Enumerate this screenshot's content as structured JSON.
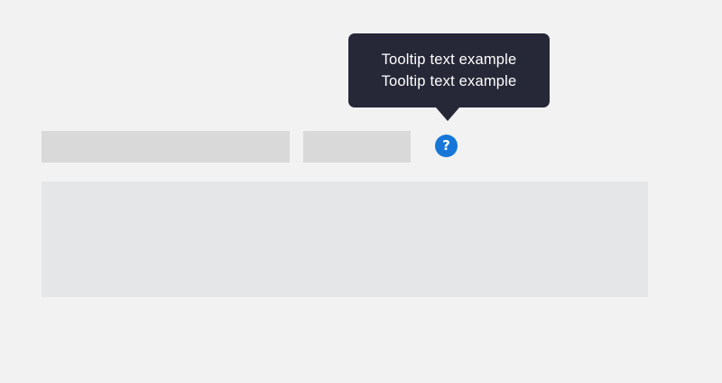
{
  "tooltip": {
    "lines": [
      "Tooltip text example",
      "Tooltip text example"
    ]
  },
  "help_icon": {
    "glyph": "?",
    "icon": "question-mark-icon",
    "color": "#1677d9"
  },
  "colors": {
    "background": "#f2f2f2",
    "placeholder": "#d9d9d9",
    "placeholder_block": "#e5e6e7",
    "tooltip_background": "#262838"
  }
}
